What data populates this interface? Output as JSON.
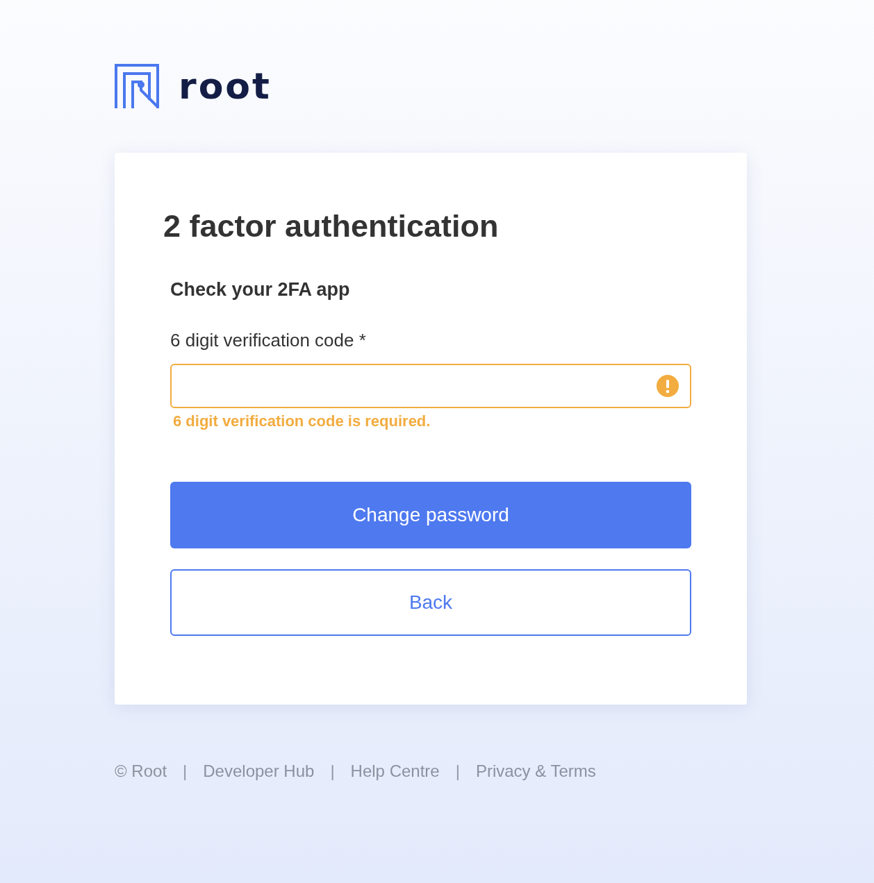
{
  "logo": {
    "text": "root"
  },
  "card": {
    "title": "2 factor authentication",
    "subtitle": "Check your 2FA app",
    "field": {
      "label": "6 digit verification code *",
      "error": true,
      "error_message": "6 digit verification code is required."
    },
    "buttons": [
      {
        "label": "Change password",
        "kind": "primary"
      },
      {
        "label": "Back",
        "kind": "secondary"
      }
    ]
  },
  "footer": [
    {
      "kind": "text",
      "label": "© Root"
    },
    {
      "kind": "separator",
      "label": "|"
    },
    {
      "kind": "link",
      "label": "Developer Hub"
    },
    {
      "kind": "separator",
      "label": "|"
    },
    {
      "kind": "link",
      "label": "Help Centre"
    },
    {
      "kind": "separator",
      "label": "|"
    },
    {
      "kind": "link",
      "label": "Privacy & Terms"
    }
  ]
}
